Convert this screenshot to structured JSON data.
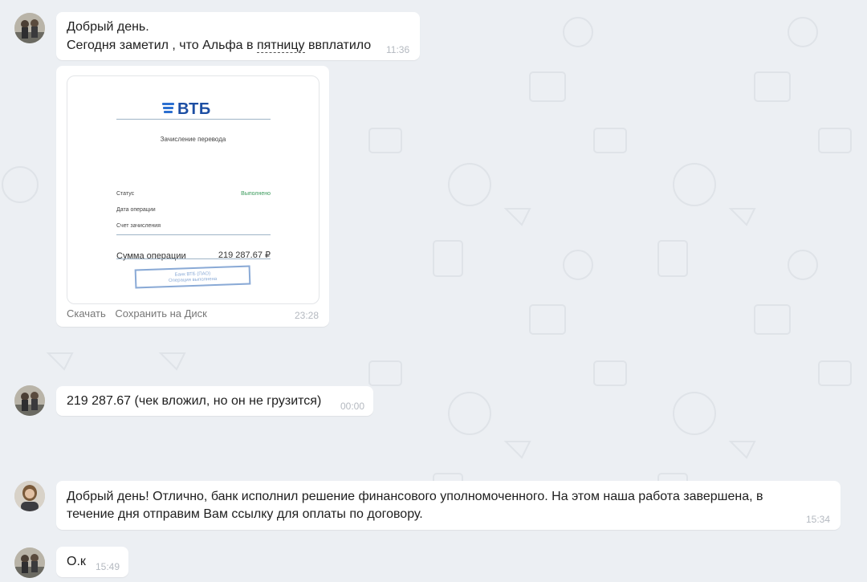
{
  "messages": [
    {
      "lines": [
        "Добрый день.",
        "Сегодня заметил , что Альфа в ",
        "пятницу",
        " ввплатило"
      ],
      "time": "11:36"
    },
    {
      "file": {
        "bank_name": "ВТБ",
        "heading": "Зачисление перевода",
        "rows": [
          {
            "label": "Статус",
            "value": "Выполнено"
          },
          {
            "label": "Дата операции",
            "value": ""
          },
          {
            "label": "Счет зачисления",
            "value": ""
          }
        ],
        "sum_label": "Сумма операции",
        "sum_value": "219 287.67 ₽",
        "stamp_line1": "Банк ВТБ (ПАО)",
        "stamp_line2": "Операция выполнена",
        "status_color": "#3a9a5b"
      },
      "actions": {
        "download": "Скачать",
        "save_to_disk": "Сохранить на Диск"
      },
      "time": "23:28"
    },
    {
      "text": "219 287.67 (чек вложил, но он не грузится)",
      "time": "00:00"
    },
    {
      "line1": "Добрый день! Отлично, банк исполнил решение финансового уполномоченного. На этом наша работа завершена, в",
      "line2": "течение дня отправим Вам ссылку для оплаты по договору.",
      "time": "15:34"
    },
    {
      "text": "О.к",
      "time": "15:49"
    }
  ],
  "colors": {
    "background": "#eceff3",
    "bubble": "#ffffff",
    "timestamp": "#b4b9c0",
    "vtb_blue": "#1c4ea3"
  }
}
